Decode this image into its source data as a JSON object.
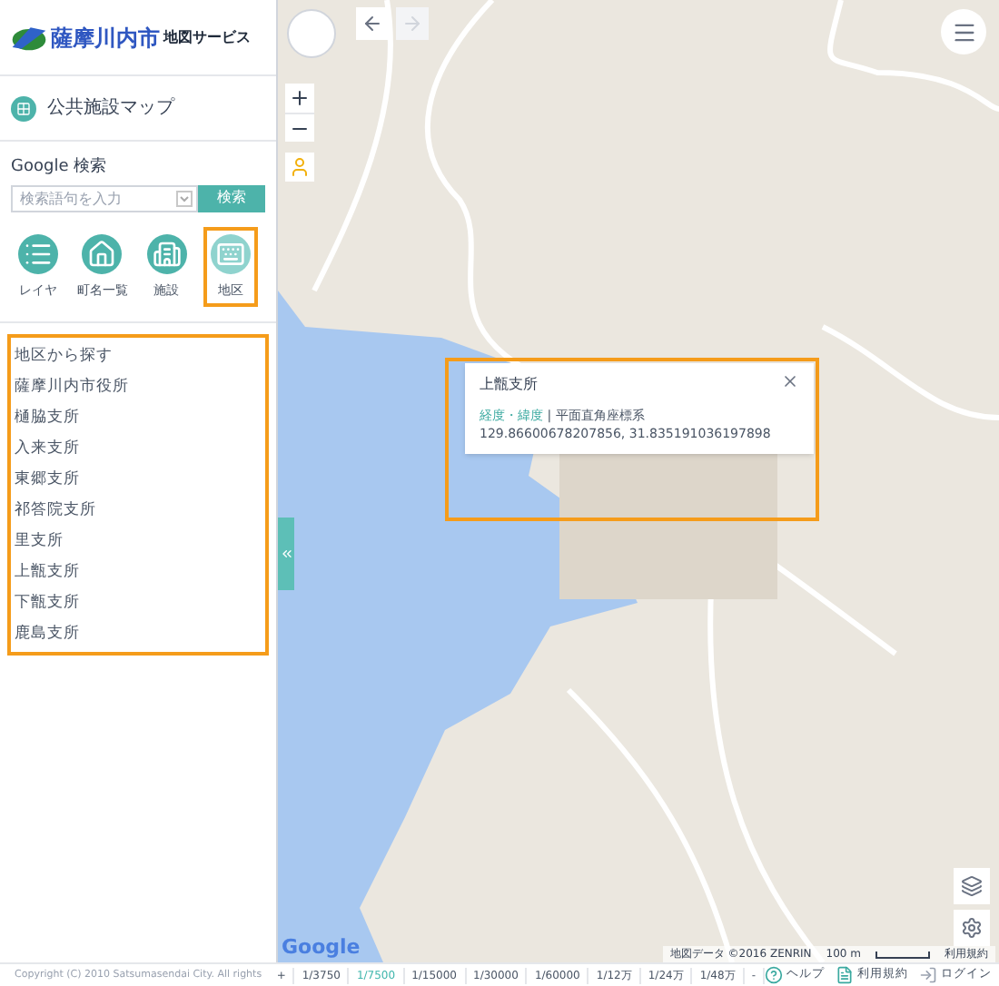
{
  "header": {
    "logo_main": "薩摩川内市",
    "logo_sub": "地図サービス"
  },
  "menu_title": "公共施設マップ",
  "search": {
    "label": "Google 検索",
    "placeholder": "検索語句を入力",
    "button": "検索"
  },
  "tools": [
    {
      "label": "レイヤ",
      "kind": "layers",
      "selected": false
    },
    {
      "label": "町名一覧",
      "kind": "towns",
      "selected": false
    },
    {
      "label": "施設",
      "kind": "facilities",
      "selected": false
    },
    {
      "label": "地区",
      "kind": "district",
      "selected": true
    }
  ],
  "district": {
    "title": "地区から探す",
    "items": [
      "薩摩川内市役所",
      "樋脇支所",
      "入来支所",
      "東郷支所",
      "祁答院支所",
      "里支所",
      "上甑支所",
      "下甑支所",
      "鹿島支所"
    ]
  },
  "popup": {
    "title": "上甑支所",
    "link": "経度・緯度",
    "label": "| 平面直角座標系",
    "coords": "129.86600678207856, 31.835191036197898"
  },
  "attribution": {
    "data": "地図データ ©2016 ZENRIN",
    "scale": "100 m",
    "terms": "利用規約",
    "logo": "Google"
  },
  "footer": {
    "copyright": "Copyright (C) 2010 Satsumasendai City. All rights",
    "scales": [
      {
        "label": "+",
        "selected": false
      },
      {
        "label": "1/3750",
        "selected": false
      },
      {
        "label": "1/7500",
        "selected": true
      },
      {
        "label": "1/15000",
        "selected": false
      },
      {
        "label": "1/30000",
        "selected": false
      },
      {
        "label": "1/60000",
        "selected": false
      },
      {
        "label": "1/12万",
        "selected": false
      },
      {
        "label": "1/24万",
        "selected": false
      },
      {
        "label": "1/48万",
        "selected": false
      },
      {
        "label": "-",
        "selected": false
      }
    ],
    "links": [
      {
        "label": "ヘルプ",
        "kind": "help"
      },
      {
        "label": "利用規約",
        "kind": "terms"
      },
      {
        "label": "ログイン",
        "kind": "login"
      }
    ]
  }
}
